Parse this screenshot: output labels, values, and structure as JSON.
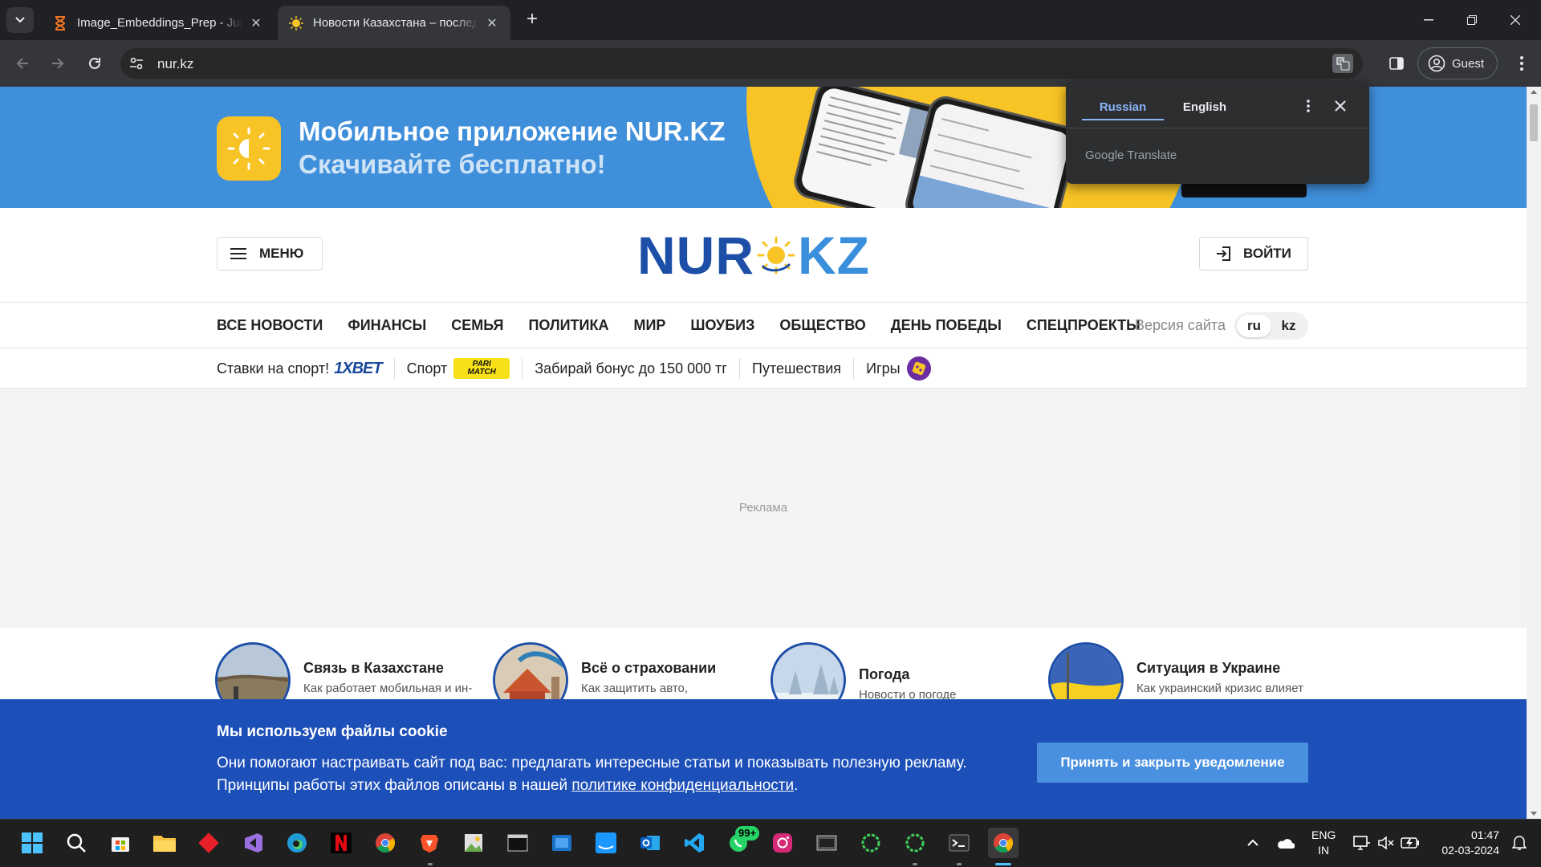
{
  "browser": {
    "tabs": [
      {
        "title": "Image_Embeddings_Prep - Jupy",
        "active": false
      },
      {
        "title": "Новости Казахстана – последн",
        "active": true
      }
    ],
    "url": "nur.kz",
    "profile_label": "Guest"
  },
  "translate_popup": {
    "source_lang": "Russian",
    "target_lang": "English",
    "brand": "Google Translate"
  },
  "promo": {
    "headline": "Мобильное приложение NUR.KZ",
    "subline": "Скачивайте бесплатно!"
  },
  "header": {
    "menu_label": "МЕНЮ",
    "logo_left": "NUR",
    "logo_right": "KZ",
    "login_label": "ВОЙТИ"
  },
  "categories": [
    "ВСЕ НОВОСТИ",
    "ФИНАНСЫ",
    "СЕМЬЯ",
    "ПОЛИТИКА",
    "МИР",
    "ШОУБИЗ",
    "ОБЩЕСТВО",
    "ДЕНЬ ПОБЕДЫ",
    "СПЕЦПРОЕКТЫ"
  ],
  "site_version": {
    "label": "Версия сайта",
    "options": [
      "ru",
      "kz"
    ],
    "selected": "ru"
  },
  "subnav": {
    "items": [
      "Ставки на спорт!",
      "Спорт",
      "Забирай бонус до 150 000 тг",
      "Путешествия",
      "Игры"
    ],
    "badge_1xbet": "1XBET",
    "badge_parimatch_1": "PARI",
    "badge_parimatch_2": "MATCH"
  },
  "ad_label": "Реклама",
  "topics": [
    {
      "title": "Связь в Казахстане",
      "subtitle": "Как работает мобильная и ин-тернет связь"
    },
    {
      "title": "Всё о страховании",
      "subtitle": "Как защитить авто, недвижимость и себя"
    },
    {
      "title": "Погода",
      "subtitle": "Новости о погоде"
    },
    {
      "title": "Ситуация в Украине",
      "subtitle": "Как украинский кризис влияет на мир"
    }
  ],
  "cookie": {
    "heading": "Мы используем файлы cookie",
    "body_1": "Они помогают настраивать сайт под вас: предлагать интересные статьи и показывать полезную рекламу.",
    "body_2": "Принципы работы этих файлов описаны в нашей ",
    "link": "политике конфиденциальности",
    "body_end": ".",
    "accept": "Принять и закрыть уведомление"
  },
  "taskbar": {
    "whatsapp_badge": "99+",
    "lang_line1": "ENG",
    "lang_line2": "IN",
    "time": "01:47",
    "date": "02-03-2024"
  },
  "colors": {
    "brand_blue": "#1d4fa8",
    "brand_light_blue": "#3a8fdc",
    "sun_yellow": "#f7c325",
    "cookie_bg": "#1d4fb8",
    "accept_btn": "#4a90e0"
  }
}
